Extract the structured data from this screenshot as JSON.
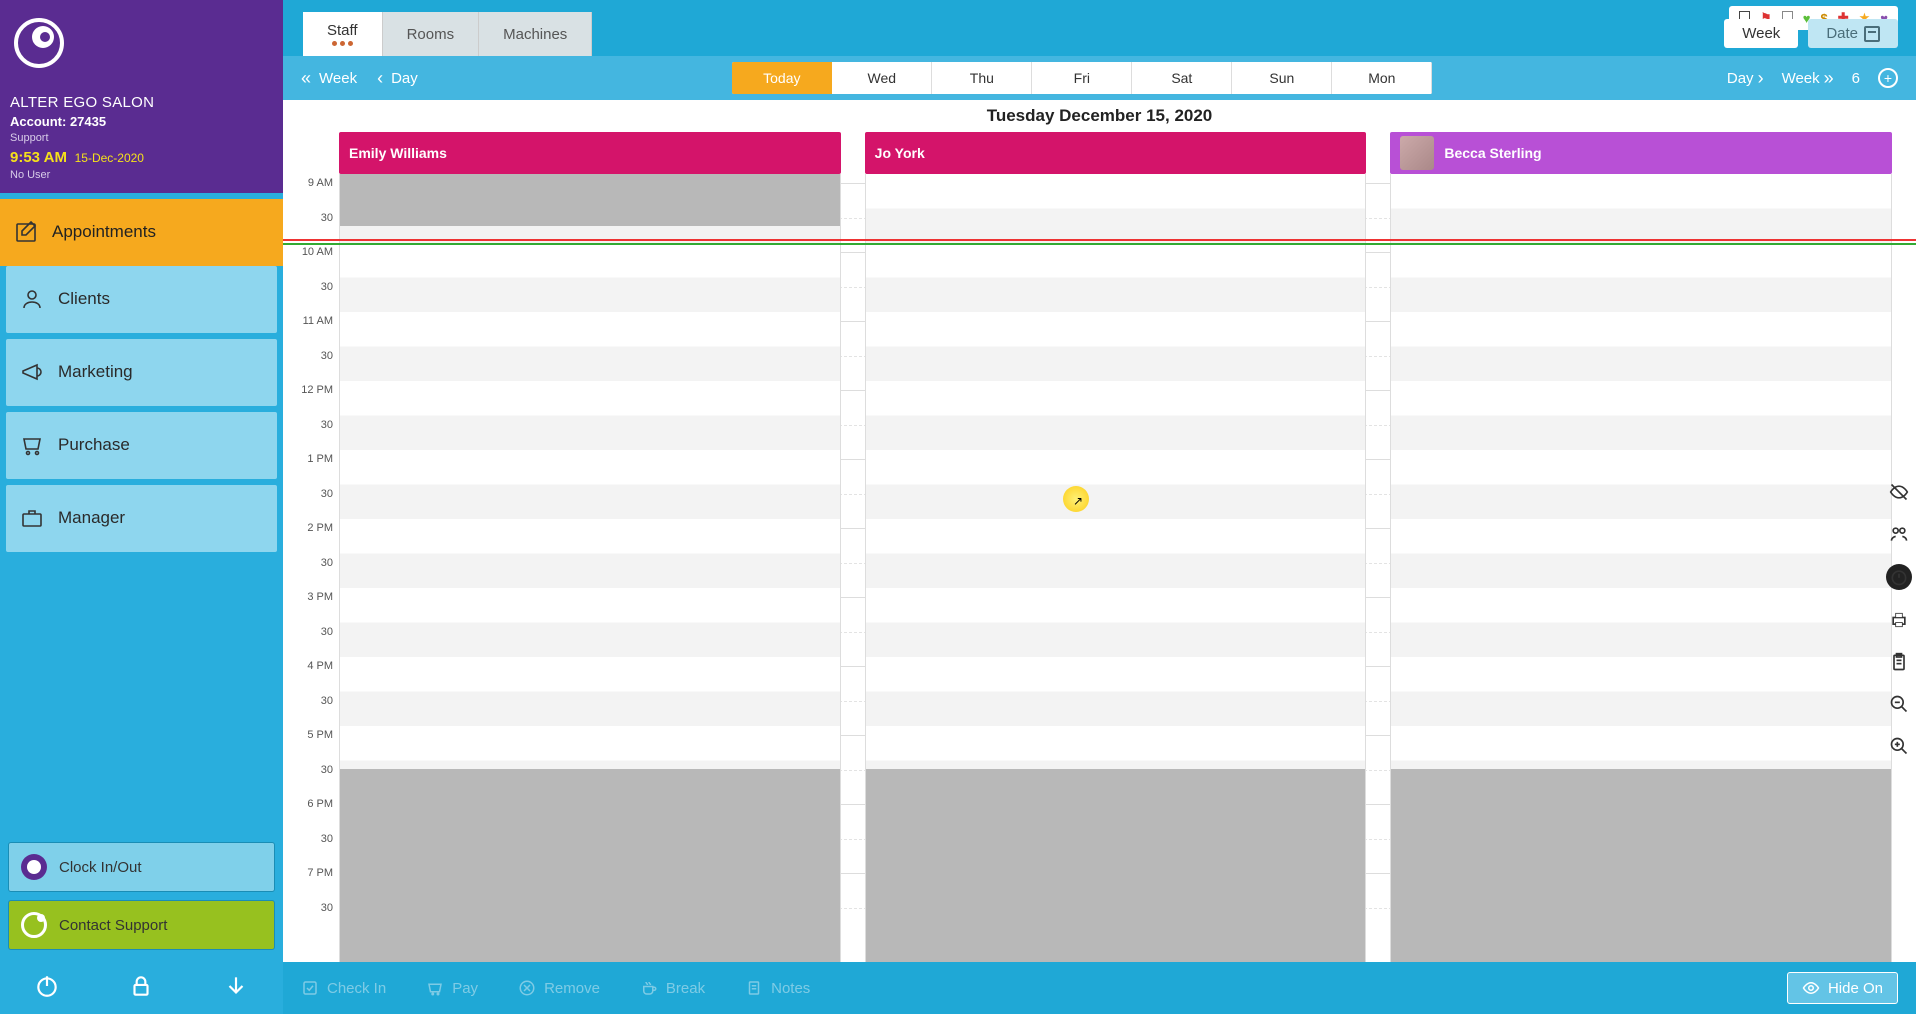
{
  "account": {
    "salon_name": "ALTER EGO SALON",
    "account_label": "Account: 27435",
    "role": "Support",
    "time": "9:53 AM",
    "date": "15-Dec-2020",
    "user": "No User"
  },
  "nav": {
    "appointments": "Appointments",
    "clients": "Clients",
    "marketing": "Marketing",
    "purchase": "Purchase",
    "manager": "Manager"
  },
  "side_buttons": {
    "clock": "Clock In/Out",
    "support": "Contact Support"
  },
  "tabs": {
    "staff": "Staff",
    "rooms": "Rooms",
    "machines": "Machines"
  },
  "topright": {
    "week": "Week",
    "date": "Date"
  },
  "daynav": {
    "back_week": "Week",
    "back_day": "Day",
    "days": [
      "Today",
      "Wed",
      "Thu",
      "Fri",
      "Sat",
      "Sun",
      "Mon"
    ],
    "fwd_day": "Day",
    "fwd_week": "Week",
    "count": "6"
  },
  "calendar": {
    "title": "Tuesday December 15, 2020",
    "staff": [
      {
        "name": "Emily Williams",
        "color": "pink",
        "avatar": false
      },
      {
        "name": "Jo York",
        "color": "pink",
        "avatar": false
      },
      {
        "name": "Becca Sterling",
        "color": "purple",
        "avatar": true
      }
    ],
    "time_labels": [
      "9 AM",
      "30",
      "10 AM",
      "30",
      "11 AM",
      "30",
      "12 PM",
      "30",
      "1 PM",
      "30",
      "2 PM",
      "30",
      "3 PM",
      "30",
      "4 PM",
      "30",
      "5 PM",
      "30",
      "6 PM",
      "30",
      "7 PM",
      "30"
    ]
  },
  "actionbar": {
    "checkin": "Check In",
    "pay": "Pay",
    "remove": "Remove",
    "break": "Break",
    "notes": "Notes",
    "hide": "Hide On"
  }
}
